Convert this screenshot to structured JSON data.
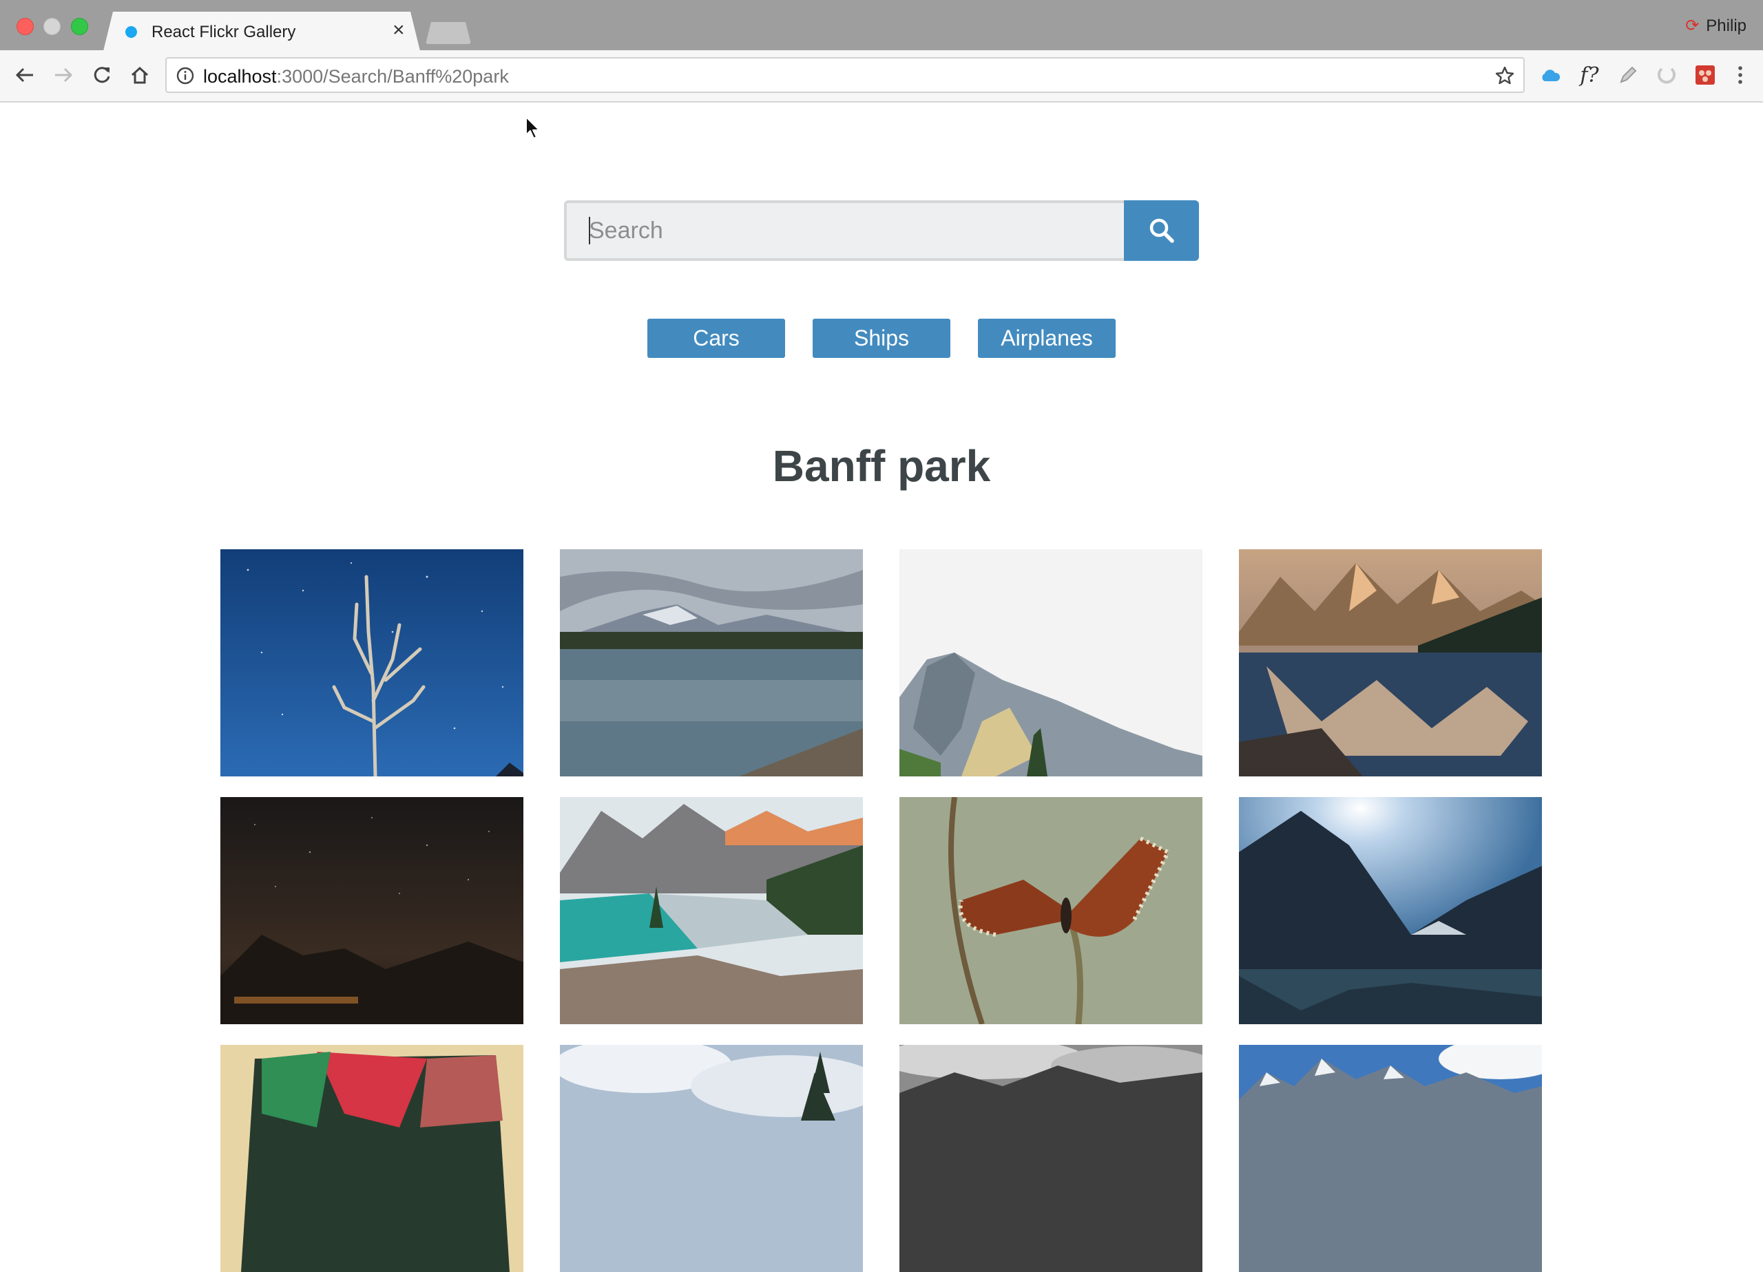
{
  "browser": {
    "tab_title": "React Flickr Gallery",
    "tab_close": "×",
    "profile_name": "Philip",
    "url_host": "localhost",
    "url_path": ":3000/Search/Banff%20park",
    "extensions": [
      "cloud-icon",
      "f?",
      "pencil-icon",
      "circle-icon",
      "red-extension-icon"
    ],
    "ext_f_label": "f?"
  },
  "search": {
    "placeholder": "Search",
    "value": ""
  },
  "nav": {
    "items": [
      "Cars",
      "Ships",
      "Airplanes"
    ]
  },
  "results": {
    "title": "Banff park",
    "photos": [
      "starry-sky-dead-tree",
      "mountain-lake-reflection",
      "snowy-mountain-peak",
      "moraine-lake-reflection",
      "night-sky-valley",
      "turquoise-lake-peaks",
      "mourning-cloak-butterfly",
      "lake-louise-sun",
      "aurora-abstract",
      "winter-pine-clouds",
      "black-white-mountains",
      "blue-sky-snow-peaks"
    ]
  },
  "colors": {
    "accent": "#438bbf",
    "title_text": "#3d4548",
    "chrome": "#9e9e9e"
  }
}
